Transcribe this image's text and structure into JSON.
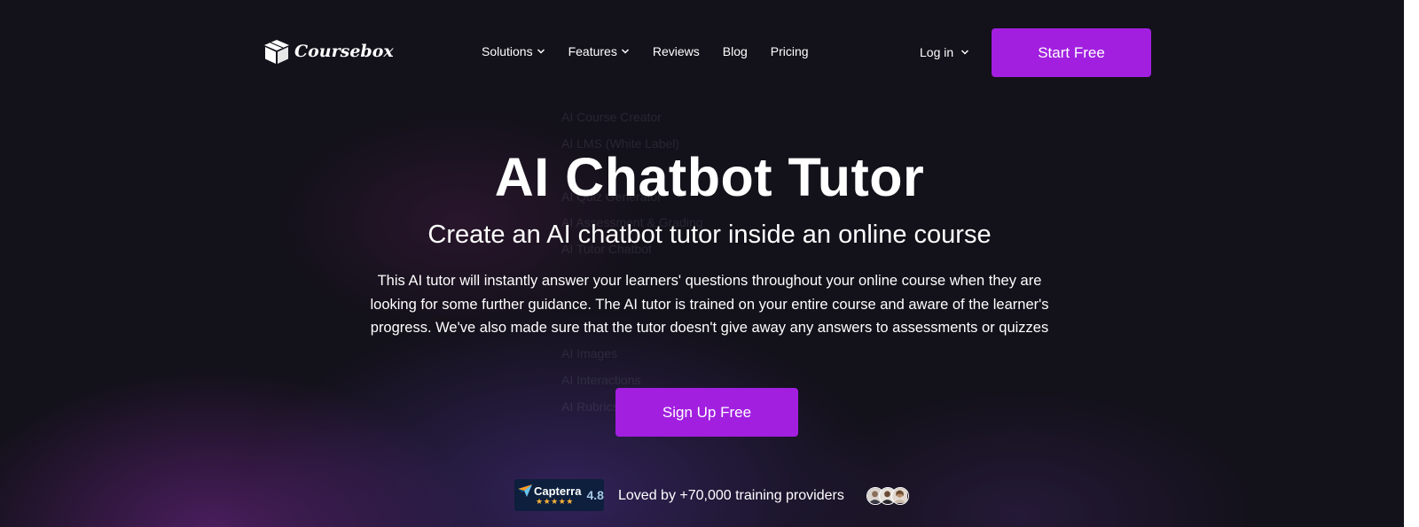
{
  "header": {
    "logo_text": "Coursebox",
    "logo_icon": "box-icon",
    "nav": [
      {
        "label": "Solutions",
        "has_dropdown": true
      },
      {
        "label": "Features",
        "has_dropdown": true
      },
      {
        "label": "Reviews",
        "has_dropdown": false
      },
      {
        "label": "Blog",
        "has_dropdown": false
      },
      {
        "label": "Pricing",
        "has_dropdown": false
      }
    ],
    "login_label": "Log in",
    "start_label": "Start Free"
  },
  "dropdown_ghost": [
    "AI Course Creator",
    "AI LMS (White Label)",
    "AI Quiz Generator",
    "AI Assessment & Grading",
    "AI Tutor Chatbot",
    "AI Images",
    "AI Interactions",
    "AI Rubrics"
  ],
  "hero": {
    "title": "AI Chatbot Tutor",
    "subtitle": "Create an AI chatbot tutor inside an online course",
    "description": "This AI tutor will instantly answer your learners' questions throughout your online course when they are looking for some further guidance. The AI tutor is trained on your entire course and aware of the learner's progress. We've also made sure that the tutor doesn't give away any answers to assessments or quizzes",
    "cta_label": "Sign Up Free"
  },
  "social_proof": {
    "capterra_label": "Capterra",
    "capterra_rating": "4.8",
    "capterra_stars": "★★★★★",
    "loved_text": "Loved by +70,000 training providers",
    "avatar_count": 3
  },
  "colors": {
    "background": "#13111a",
    "accent": "#a21fe0",
    "capterra_bg": "#0d1f3c",
    "star": "#ffb43a"
  }
}
